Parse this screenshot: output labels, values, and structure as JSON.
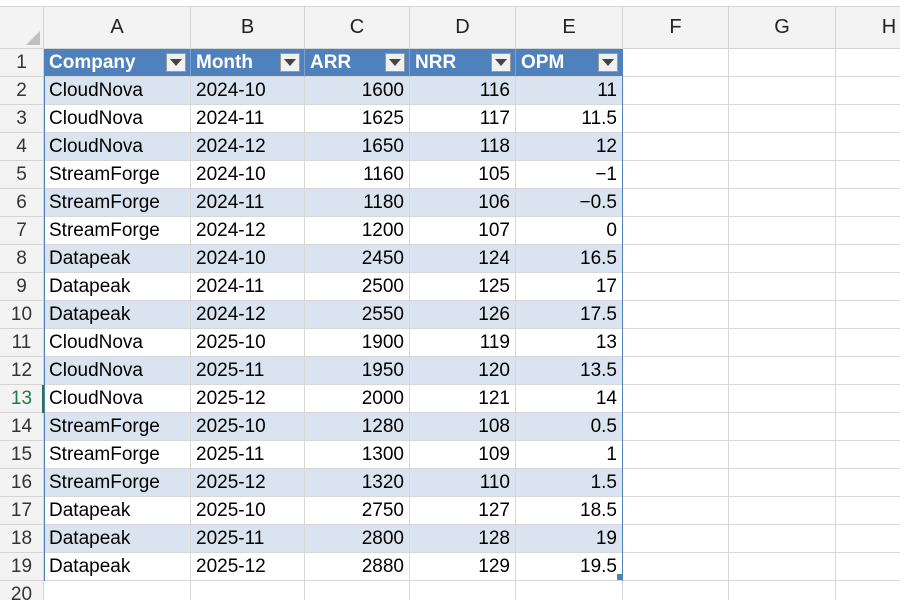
{
  "columns": [
    "A",
    "B",
    "C",
    "D",
    "E",
    "F",
    "G",
    "H"
  ],
  "row_numbers": [
    "1",
    "2",
    "3",
    "4",
    "5",
    "6",
    "7",
    "8",
    "9",
    "10",
    "11",
    "12",
    "13",
    "14",
    "15",
    "16",
    "17",
    "18",
    "19",
    "20"
  ],
  "active_row": "13",
  "table": {
    "headers": [
      "Company",
      "Month",
      "ARR",
      "NRR",
      "OPM"
    ],
    "rows": [
      [
        "CloudNova",
        "2024-10",
        "1600",
        "116",
        "11"
      ],
      [
        "CloudNova",
        "2024-11",
        "1625",
        "117",
        "11.5"
      ],
      [
        "CloudNova",
        "2024-12",
        "1650",
        "118",
        "12"
      ],
      [
        "StreamForge",
        "2024-10",
        "1160",
        "105",
        "−1"
      ],
      [
        "StreamForge",
        "2024-11",
        "1180",
        "106",
        "−0.5"
      ],
      [
        "StreamForge",
        "2024-12",
        "1200",
        "107",
        "0"
      ],
      [
        "Datapeak",
        "2024-10",
        "2450",
        "124",
        "16.5"
      ],
      [
        "Datapeak",
        "2024-11",
        "2500",
        "125",
        "17"
      ],
      [
        "Datapeak",
        "2024-12",
        "2550",
        "126",
        "17.5"
      ],
      [
        "CloudNova",
        "2025-10",
        "1900",
        "119",
        "13"
      ],
      [
        "CloudNova",
        "2025-11",
        "1950",
        "120",
        "13.5"
      ],
      [
        "CloudNova",
        "2025-12",
        "2000",
        "121",
        "14"
      ],
      [
        "StreamForge",
        "2025-10",
        "1280",
        "108",
        "0.5"
      ],
      [
        "StreamForge",
        "2025-11",
        "1300",
        "109",
        "1"
      ],
      [
        "StreamForge",
        "2025-12",
        "1320",
        "110",
        "1.5"
      ],
      [
        "Datapeak",
        "2025-10",
        "2750",
        "127",
        "18.5"
      ],
      [
        "Datapeak",
        "2025-11",
        "2800",
        "128",
        "19"
      ],
      [
        "Datapeak",
        "2025-12",
        "2880",
        "129",
        "19.5"
      ]
    ]
  },
  "colors": {
    "header_fill": "#4f81bd",
    "band_fill": "#dae3f0",
    "active_indicator": "#1f7a45"
  },
  "icons": {
    "filter": "filter-dropdown-icon",
    "corner": "select-all-icon"
  }
}
